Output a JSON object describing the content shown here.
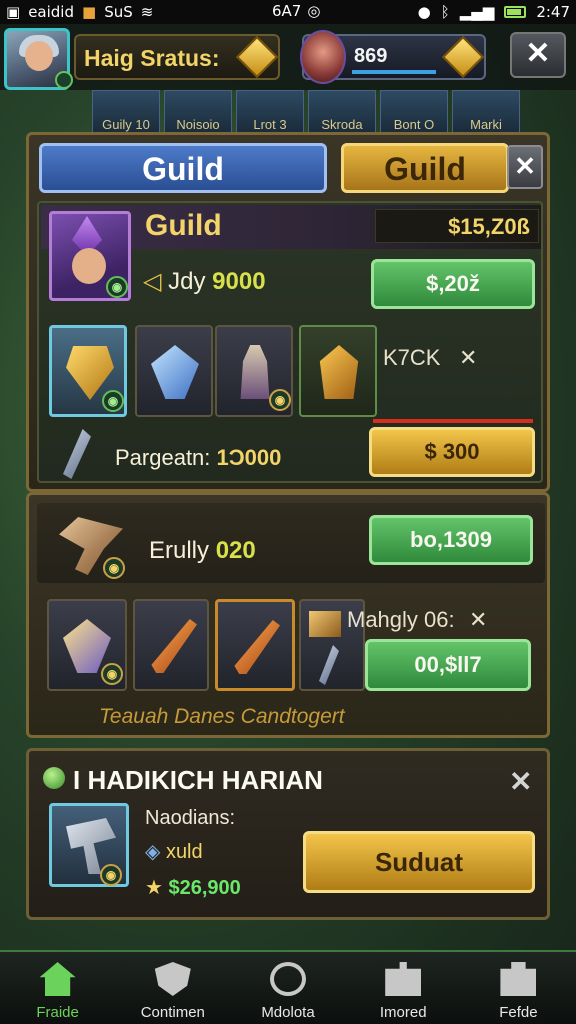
{
  "status_bar": {
    "left_text": "eaidid",
    "carrier_text": "SuS",
    "center_text": "6A7",
    "time": "2:47"
  },
  "hud": {
    "player_name": "Haig Sratus:",
    "score": "869",
    "close_label": "✕"
  },
  "hero_strip": {
    "cards": [
      "Guily 10",
      "Noisoio",
      "Lrot 3",
      "Skroda",
      "Bont O",
      "Marki"
    ]
  },
  "main_panel": {
    "tabs": [
      {
        "label": "Guild",
        "active": true
      },
      {
        "label": "Guild",
        "active": false
      }
    ],
    "close_label": "✕",
    "guild_title": "Guild",
    "gold_amount": "$15,Z0ß",
    "member_line_prefix": "Jdy",
    "member_line_value": "9000",
    "green_button_label": "$,20ž",
    "items_side_text": "K7CK",
    "items_side_mark": "✕",
    "footer_label": "Pargeatn:",
    "footer_value": "1Ɔ000",
    "gold_button_label": "$ 300"
  },
  "mid_panel": {
    "title_prefix": "Erully",
    "title_value": "020",
    "green_button_label": "bo,1309",
    "side_text": "Mahgly 06:",
    "side_mark": "✕",
    "green_button2_label": "00,$ll7",
    "footer_note": "Teauah Danes Candtogert"
  },
  "bottom_panel": {
    "title": "I HADIKICH HARIAN",
    "close_label": "✕",
    "label_1": "Naodians:",
    "label_2": "xuld",
    "price": "$26,900",
    "button_label": "Suduat"
  },
  "nav": {
    "items": [
      {
        "label": "Fraide",
        "icon": "home-icon",
        "active": true
      },
      {
        "label": "Contimen",
        "icon": "shield-icon",
        "active": false
      },
      {
        "label": "Mdolota",
        "icon": "circle-icon",
        "active": false
      },
      {
        "label": "Imored",
        "icon": "puzzle-icon",
        "active": false
      },
      {
        "label": "Fefde",
        "icon": "bag-icon",
        "active": false
      }
    ]
  },
  "colors": {
    "gold": "#f3d469",
    "blue_tab": "#2a4f93",
    "green_button": "#2f8a3b",
    "active_nav": "#6bd25b"
  }
}
